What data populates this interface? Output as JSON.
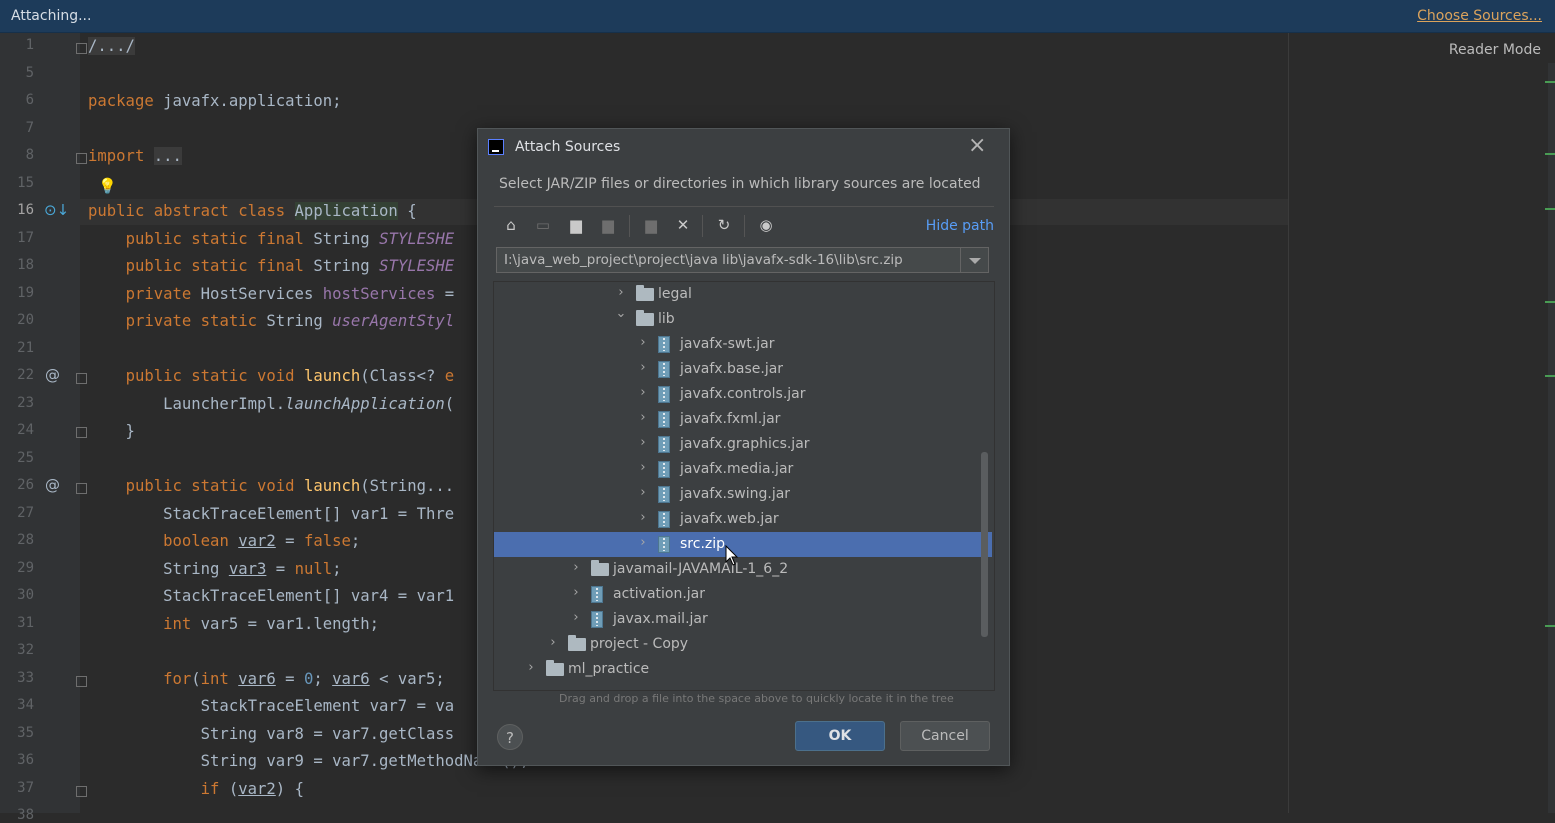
{
  "topbar": {
    "status": "Attaching...",
    "choose_sources": "Choose Sources..."
  },
  "editor": {
    "reader_mode": "Reader Mode",
    "line_numbers": [
      "1",
      "5",
      "6",
      "7",
      "8",
      "15",
      "16",
      "17",
      "18",
      "19",
      "20",
      "21",
      "22",
      "23",
      "24",
      "25",
      "26",
      "27",
      "28",
      "29",
      "30",
      "31",
      "32",
      "33",
      "34",
      "35",
      "36",
      "37",
      "38"
    ],
    "current_line": "16"
  },
  "dialog": {
    "title": "Attach Sources",
    "description": "Select JAR/ZIP files or directories in which library sources are located",
    "hide_path": "Hide path",
    "path_value": "I:\\java_web_project\\project\\java lib\\javafx-sdk-16\\lib\\src.zip",
    "tree": [
      {
        "label": "legal",
        "type": "folder",
        "level": 3,
        "expanded": false
      },
      {
        "label": "lib",
        "type": "folder",
        "level": 3,
        "expanded": true
      },
      {
        "label": "javafx-swt.jar",
        "type": "jar",
        "level": 4
      },
      {
        "label": "javafx.base.jar",
        "type": "jar",
        "level": 4
      },
      {
        "label": "javafx.controls.jar",
        "type": "jar",
        "level": 4
      },
      {
        "label": "javafx.fxml.jar",
        "type": "jar",
        "level": 4
      },
      {
        "label": "javafx.graphics.jar",
        "type": "jar",
        "level": 4
      },
      {
        "label": "javafx.media.jar",
        "type": "jar",
        "level": 4
      },
      {
        "label": "javafx.swing.jar",
        "type": "jar",
        "level": 4
      },
      {
        "label": "javafx.web.jar",
        "type": "jar",
        "level": 4
      },
      {
        "label": "src.zip",
        "type": "jar",
        "level": 4,
        "selected": true
      },
      {
        "label": "javamail-JAVAMAIL-1_6_2",
        "type": "folder",
        "level": 2
      },
      {
        "label": "activation.jar",
        "type": "jar",
        "level": 2
      },
      {
        "label": "javax.mail.jar",
        "type": "jar",
        "level": 2
      },
      {
        "label": "project - Copy",
        "type": "folder",
        "level": 1
      },
      {
        "label": "ml_practice",
        "type": "folder",
        "level": 0
      }
    ],
    "hint": "Drag and drop a file into the space above to quickly locate it in the tree",
    "help_label": "?",
    "ok_label": "OK",
    "cancel_label": "Cancel",
    "close_glyph": "×"
  }
}
